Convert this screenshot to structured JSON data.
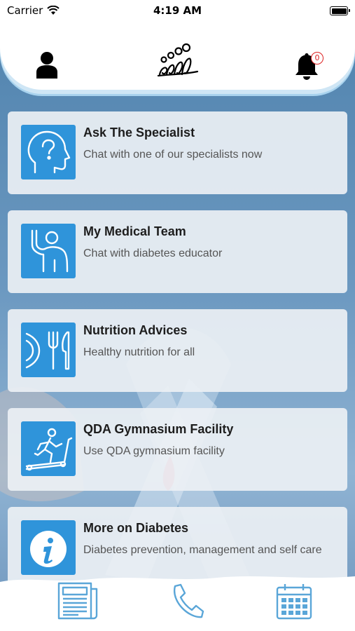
{
  "status_bar": {
    "carrier": "Carrier",
    "time": "4:19 AM"
  },
  "header": {
    "notification_count": "0"
  },
  "menu": [
    {
      "title": "Ask The Specialist",
      "subtitle": "Chat with one of our specialists now",
      "icon": "head-question-icon"
    },
    {
      "title": "My Medical Team",
      "subtitle": "Chat with diabetes educator",
      "icon": "raised-hand-person-icon"
    },
    {
      "title": "Nutrition Advices",
      "subtitle": "Healthy nutrition for all",
      "icon": "plate-fork-knife-icon"
    },
    {
      "title": "QDA Gymnasium Facility",
      "subtitle": "Use QDA gymnasium facility",
      "icon": "treadmill-icon"
    },
    {
      "title": "More on Diabetes",
      "subtitle": "Diabetes prevention, management and self care",
      "icon": "info-icon"
    }
  ],
  "bottom_nav": [
    "newspaper-icon",
    "phone-icon",
    "calendar-icon"
  ],
  "colors": {
    "accent": "#2f94da",
    "icon_blue": "#5aa6d8",
    "badge": "#dd2222"
  }
}
